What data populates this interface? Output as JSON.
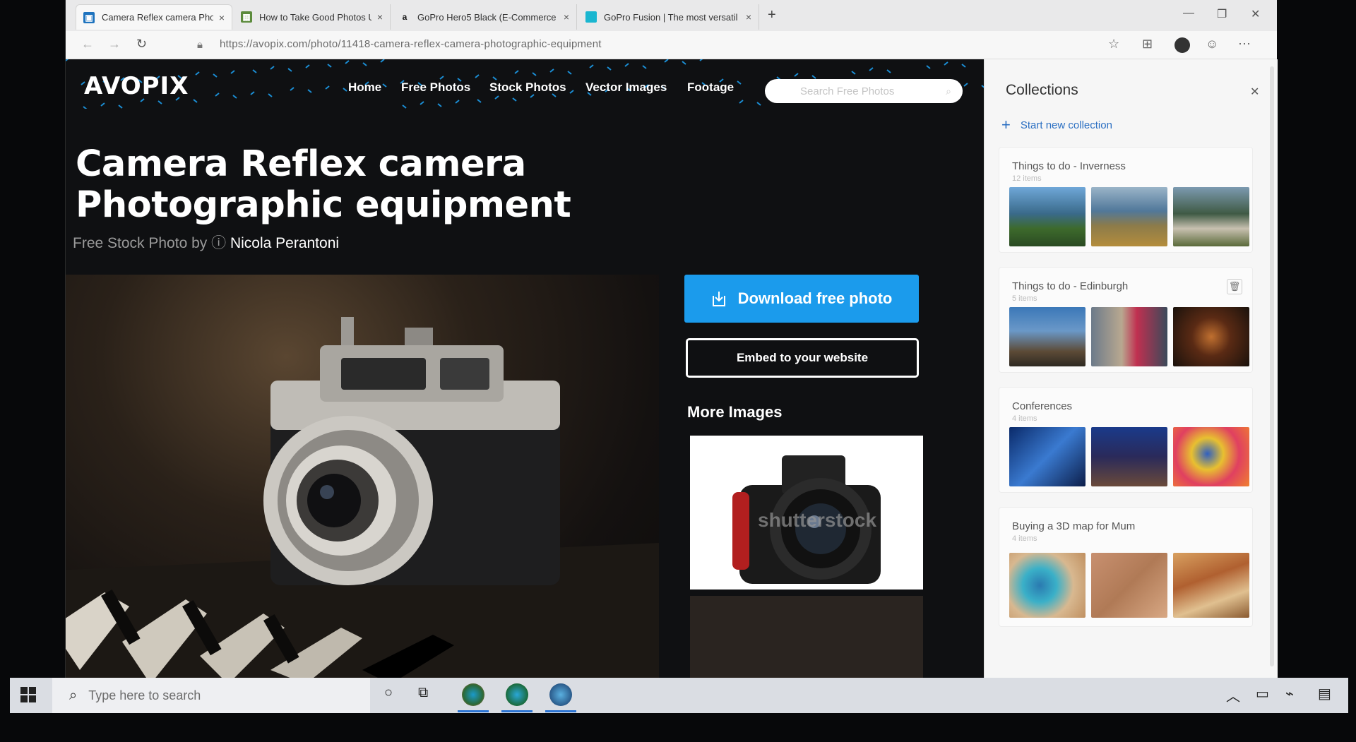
{
  "browser": {
    "tabs": [
      {
        "title": "Camera Reflex camera Photogra",
        "favicon": "avopix-favicon",
        "active": true
      },
      {
        "title": "How to Take Good Photos Using",
        "favicon": "image-favicon",
        "active": false
      },
      {
        "title": "GoPro Hero5 Black (E-Commerce",
        "favicon": "amazon-favicon",
        "active": false
      },
      {
        "title": "GoPro Fusion | The most versatil",
        "favicon": "gopro-favicon",
        "active": false
      }
    ],
    "tab_close": "×",
    "new_tab": "+",
    "url": "https://avopix.com/photo/11418-camera-reflex-camera-photographic-equipment"
  },
  "site": {
    "logo": "AVOPIX",
    "nav": [
      "Home",
      "Free Photos",
      "Stock Photos",
      "Vector Images",
      "Footage"
    ],
    "search_placeholder": "Search Free Photos",
    "title": "Camera Reflex camera Photographic equipment",
    "byline_prefix": "Free Stock Photo by",
    "author": "Nicola Perantoni",
    "download_label": "Download free photo",
    "embed_label": "Embed to your website",
    "more_images": "More Images",
    "watermark": "shutterstock"
  },
  "collections": {
    "title": "Collections",
    "new_label": "Start new collection",
    "items": [
      {
        "name": "Things to do - Inverness",
        "count": "12 items"
      },
      {
        "name": "Things to do - Edinburgh",
        "count": "5 items"
      },
      {
        "name": "Conferences",
        "count": "4 items"
      },
      {
        "name": "Buying a 3D map for Mum",
        "count": "4 items"
      }
    ]
  },
  "taskbar": {
    "search_placeholder": "Type here to search"
  }
}
